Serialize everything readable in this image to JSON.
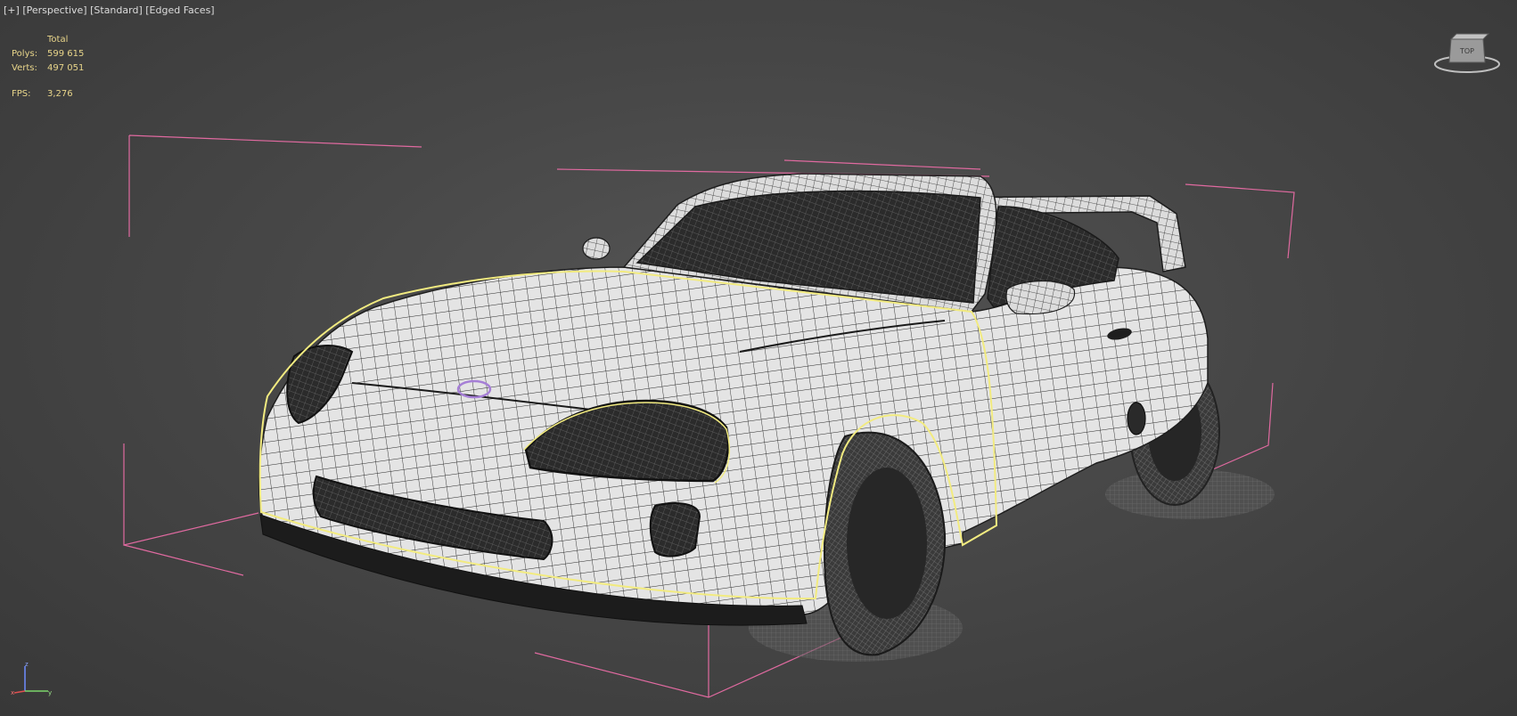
{
  "viewport": {
    "label_plus": "[+]",
    "label_view": "[Perspective]",
    "label_shading": "[Standard]",
    "label_mode": "[Edged Faces]"
  },
  "stats": {
    "header": "Total",
    "polys_label": "Polys:",
    "polys_value": "599 615",
    "verts_label": "Verts:",
    "verts_value": "497 051",
    "fps_label": "FPS:",
    "fps_value": "3,276"
  },
  "viewcube": {
    "face_label": "TOP"
  },
  "axis": {
    "x": "x",
    "y": "y",
    "z": "z"
  },
  "colors": {
    "background": "#474747",
    "bbox": "#e06aa0",
    "selection_outline": "#f2eb80",
    "body_fill": "#e6e6e6",
    "wire": "#222222",
    "stats_text": "#e8d58a"
  },
  "icons": [
    "viewcube-icon",
    "axis-tripod-icon"
  ]
}
